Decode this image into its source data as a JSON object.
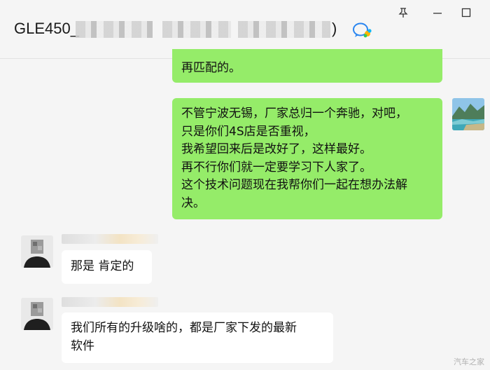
{
  "window": {
    "title_prefix": "GLE450_",
    "title_suffix": ")"
  },
  "icons": {
    "title_badge": "wecom-chat-icon",
    "pin": "pin-icon",
    "minimize": "minimize-icon",
    "maximize": "maximize-icon"
  },
  "colors": {
    "sent_bubble": "#95ec69",
    "received_bubble": "#ffffff",
    "background": "#f5f5f5"
  },
  "messages": [
    {
      "direction": "sent",
      "lines": [
        "再匹配的。"
      ]
    },
    {
      "direction": "sent",
      "lines": [
        "不管宁波无锡，厂家总归一个奔驰，对吧，",
        "只是你们4S店是否重视，",
        "我希望回来后是改好了，这样最好。",
        "再不行你们就一定要学习下人家了。",
        "这个技术问题现在我帮你们一起在想办法解",
        "决。"
      ]
    },
    {
      "direction": "received",
      "lines": [
        "那是 肯定的"
      ]
    },
    {
      "direction": "received",
      "lines": [
        "我们所有的升级啥的，都是厂家下发的最新",
        "软件"
      ]
    }
  ],
  "watermark": "汽车之家"
}
